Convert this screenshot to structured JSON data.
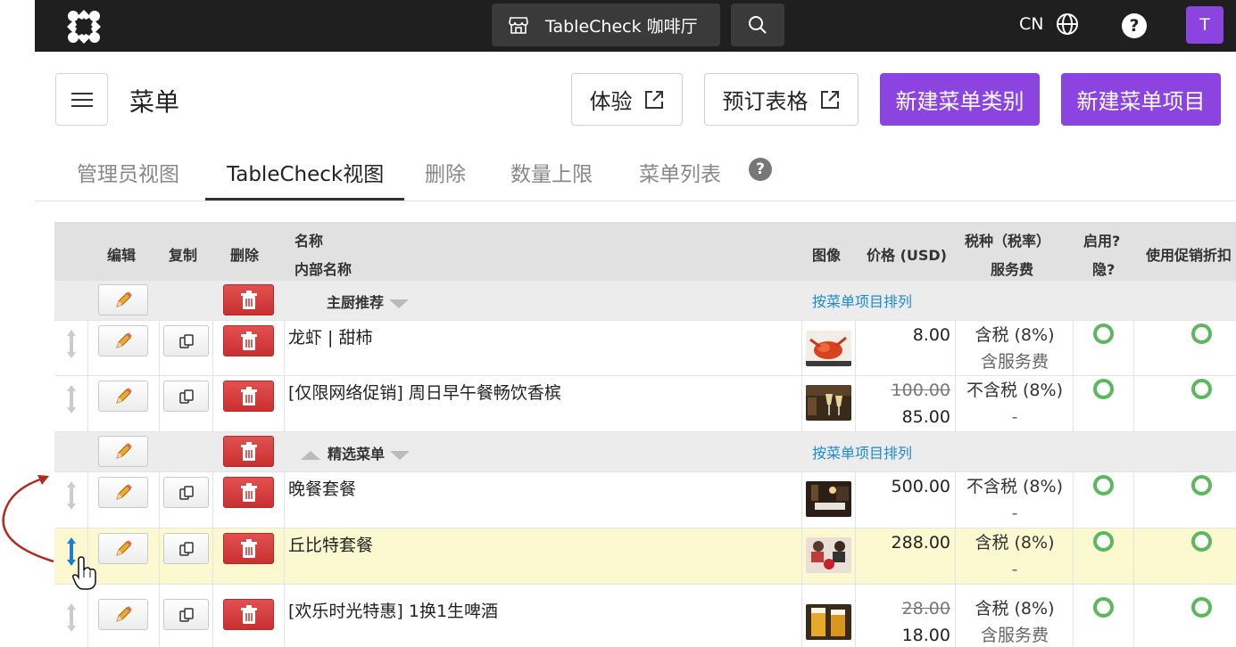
{
  "topbar": {
    "venue_name": "TableCheck 咖啡厅",
    "lang": "CN",
    "help": "?",
    "avatar_letter": "T",
    "brand_color": "#1f1f1f",
    "accent": "#8c44e0"
  },
  "header": {
    "title": "菜单",
    "btn_experience": "体验",
    "btn_reservation_form": "预订表格",
    "btn_new_category": "新建菜单类别",
    "btn_new_item": "新建菜单项目"
  },
  "tabs": [
    "管理员视图",
    "TableCheck视图",
    "删除",
    "数量上限",
    "菜单列表"
  ],
  "tab_help": "?",
  "table": {
    "headers": {
      "edit": "编辑",
      "copy": "复制",
      "delete": "删除",
      "name": "名称",
      "internal_name": "内部名称",
      "image": "图像",
      "price": "价格 (USD)",
      "tax": "税种（税率）",
      "service": "服务费",
      "enabled": "启用?",
      "hidden": "隐?",
      "promo": "使用促销折扣"
    },
    "sort_link": "按菜单项目排列",
    "categories": [
      {
        "name": "主厨推荐",
        "items": [
          {
            "name": "龙虾 | 甜柿",
            "price": "8.00",
            "old_price": "",
            "tax": "含税 (8%)",
            "service": "含服务费",
            "image": "lobster"
          },
          {
            "name": "[仅限网络促销] 周日早午餐畅饮香槟",
            "price": "85.00",
            "old_price": "100.00",
            "tax": "不含税 (8%)",
            "service": "-",
            "image": "champagne"
          }
        ]
      },
      {
        "name": "精选菜单",
        "items": [
          {
            "name": "晚餐套餐",
            "price": "500.00",
            "old_price": "",
            "tax": "不含税 (8%)",
            "service": "-",
            "image": "dining-room"
          },
          {
            "name": "丘比特套餐",
            "price": "288.00",
            "old_price": "",
            "tax": "含税 (8%)",
            "service": "-",
            "image": "couple-dinner"
          },
          {
            "name": "[欢乐时光特惠] 1换1生啤酒",
            "price": "18.00",
            "old_price": "28.00",
            "tax": "含税 (8%)",
            "service": "含服务费",
            "image": "beer"
          }
        ]
      }
    ]
  }
}
